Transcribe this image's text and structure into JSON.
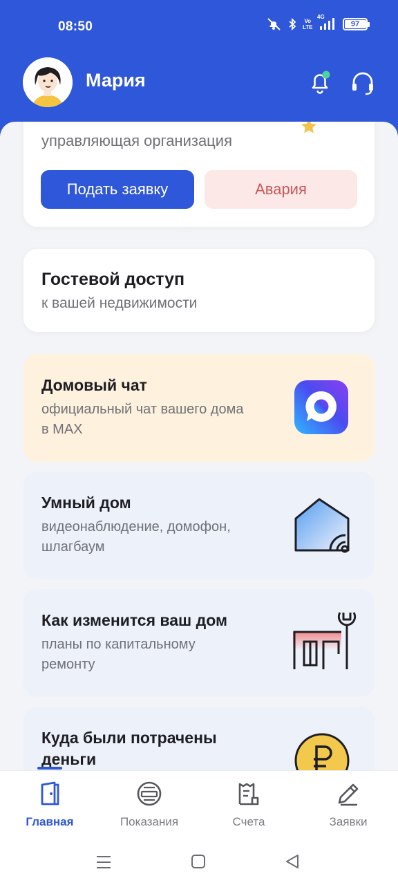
{
  "status_bar": {
    "time": "08:50",
    "battery": "97",
    "network": "4G",
    "volte": "Vo LTE"
  },
  "header": {
    "user_name": "Мария",
    "avatar_icon": "user-avatar-illustration",
    "notification_icon": "bell-icon",
    "notification_badge_color": "#4cd3a0",
    "support_icon": "headset-icon",
    "brand_color": "#2f57d9"
  },
  "company_card": {
    "subtitle": "управляющая организация",
    "submit_label": "Подать заявку",
    "emergency_label": "Авария"
  },
  "guest_card": {
    "title": "Гостевой доступ",
    "subtitle": "к вашей недвижимости"
  },
  "chat_card": {
    "title": "Домовый чат",
    "subtitle_line1": "официальный чат вашего дома",
    "subtitle_line2": "в MAX",
    "icon": "max-messenger-icon"
  },
  "smart_card": {
    "title": "Умный дом",
    "subtitle_line1": "видеонаблюдение, домофон,",
    "subtitle_line2": "шлагбаум",
    "icon": "smart-house-icon"
  },
  "repair_card": {
    "title": "Как изменится ваш дом",
    "subtitle_line1": "планы по капитальному",
    "subtitle_line2": "ремонту",
    "icon": "building-wrench-icon"
  },
  "money_card": {
    "title_line1": "Куда были потрачены",
    "title_line2": "деньги",
    "icon": "ruble-coin-icon"
  },
  "nav": {
    "home": "Главная",
    "readings": "Показания",
    "bills": "Счета",
    "requests": "Заявки"
  }
}
